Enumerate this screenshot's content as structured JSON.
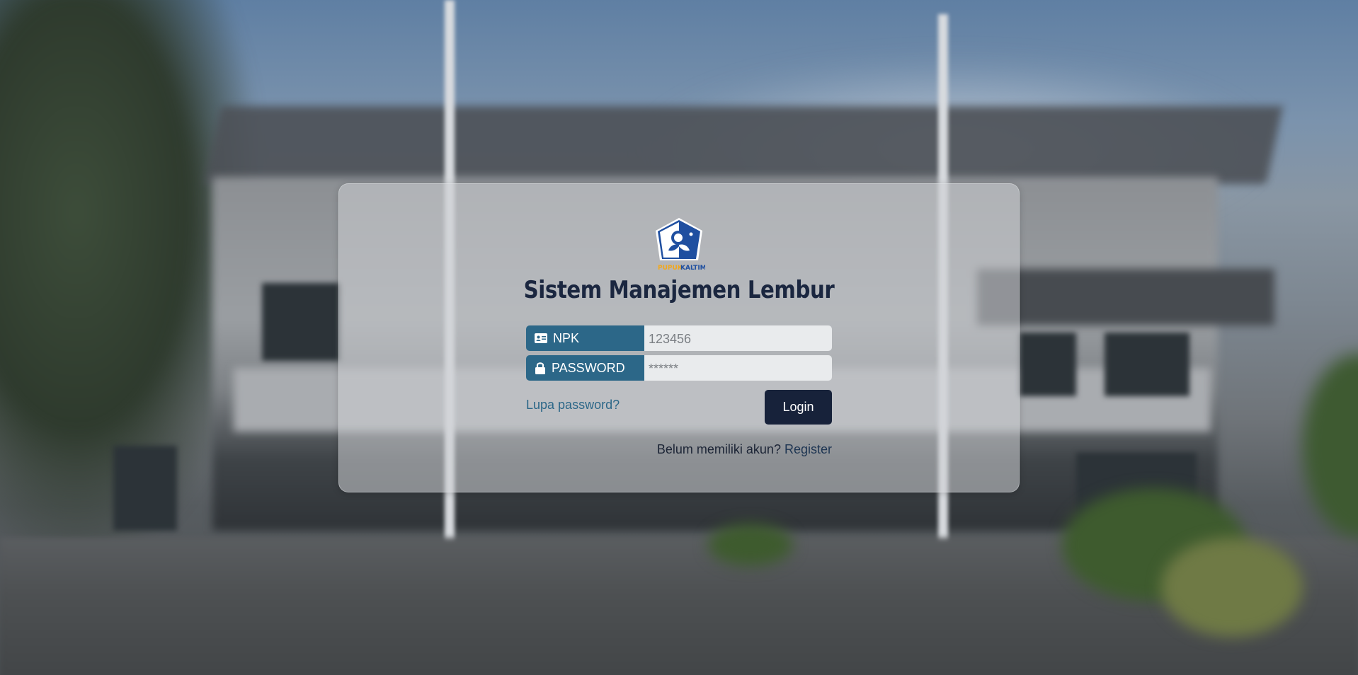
{
  "page": {
    "title": "Sistem Manajemen Lembur"
  },
  "logo": {
    "brand_text_1": "PUPUK",
    "brand_text_2": "KALTIM",
    "colors": {
      "shield": "#1f4fa0",
      "accent": "#f3a81c"
    }
  },
  "form": {
    "npk": {
      "label": "NPK",
      "placeholder": "123456",
      "icon": "id-card-icon"
    },
    "password": {
      "label": "PASSWORD",
      "placeholder": "******",
      "icon": "lock-icon"
    },
    "forgot_label": "Lupa password?",
    "login_label": "Login",
    "register_prompt": "Belum memiliki akun?",
    "register_label": "Register"
  },
  "colors": {
    "label_bg": "#2c6788",
    "button_bg": "#17223a",
    "title": "#1b2740"
  }
}
